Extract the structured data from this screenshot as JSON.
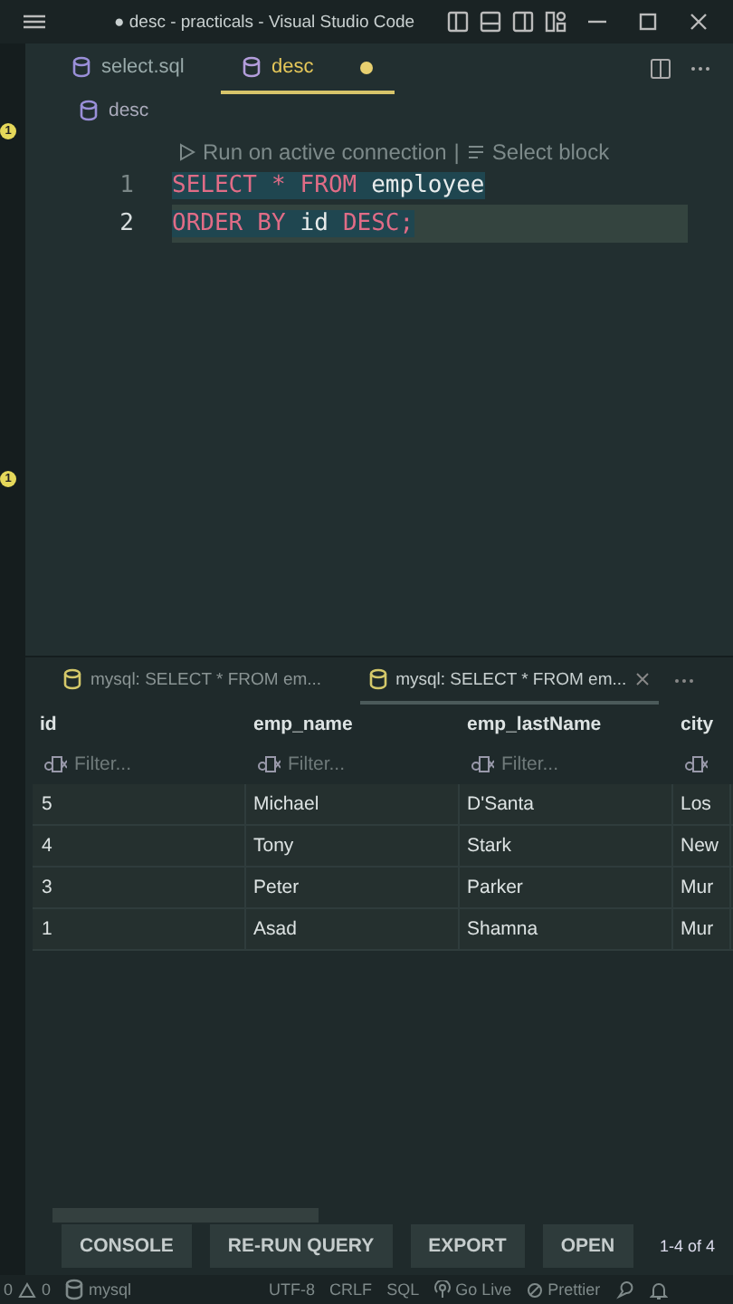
{
  "window": {
    "title": "● desc - practicals - Visual Studio Code"
  },
  "activity_bar": {
    "badges": [
      "1",
      "1"
    ]
  },
  "editor_tabs": [
    {
      "label": "select.sql",
      "selected": false,
      "modified": false
    },
    {
      "label": "desc",
      "selected": true,
      "modified": true
    }
  ],
  "breadcrumb": "desc",
  "codelens": {
    "run": "Run on active connection",
    "separator": "|",
    "select": "Select block"
  },
  "code_lines": [
    {
      "number": "1",
      "current": false,
      "tokens": [
        {
          "text": "SELECT",
          "kind": "keyword"
        },
        {
          "text": "*",
          "kind": "keyword"
        },
        {
          "text": "FROM",
          "kind": "keyword"
        },
        {
          "text": "employee",
          "kind": "ident"
        }
      ]
    },
    {
      "number": "2",
      "current": true,
      "tokens": [
        {
          "text": "ORDER",
          "kind": "keyword"
        },
        {
          "text": "BY",
          "kind": "keyword"
        },
        {
          "text": "id",
          "kind": "ident"
        },
        {
          "text": "DESC;",
          "kind": "keyword"
        }
      ]
    }
  ],
  "panel_tabs": [
    {
      "label": "mysql: SELECT * FROM em...",
      "selected": false
    },
    {
      "label": "mysql: SELECT * FROM em...",
      "selected": true
    }
  ],
  "table": {
    "columns": [
      {
        "name": "id",
        "placeholder": "Filter..."
      },
      {
        "name": "emp_name",
        "placeholder": "Filter..."
      },
      {
        "name": "emp_lastName",
        "placeholder": "Filter..."
      },
      {
        "name": "city"
      }
    ],
    "rows": [
      [
        "5",
        "Michael",
        "D'Santa",
        "Los"
      ],
      [
        "4",
        "Tony",
        "Stark",
        "New"
      ],
      [
        "3",
        "Peter",
        "Parker",
        "Mur"
      ],
      [
        "1",
        "Asad",
        "Shamna",
        "Mur"
      ]
    ]
  },
  "result_buttons": [
    "CONSOLE",
    "RE-RUN QUERY",
    "EXPORT",
    "OPEN"
  ],
  "result_count": "1-4 of 4",
  "status_bar": {
    "errors": "0",
    "warnings": "0",
    "connection": "mysql",
    "encoding": "UTF-8",
    "eol": "CRLF",
    "language": "SQL",
    "go_live": "Go Live",
    "prettier": "Prettier"
  }
}
